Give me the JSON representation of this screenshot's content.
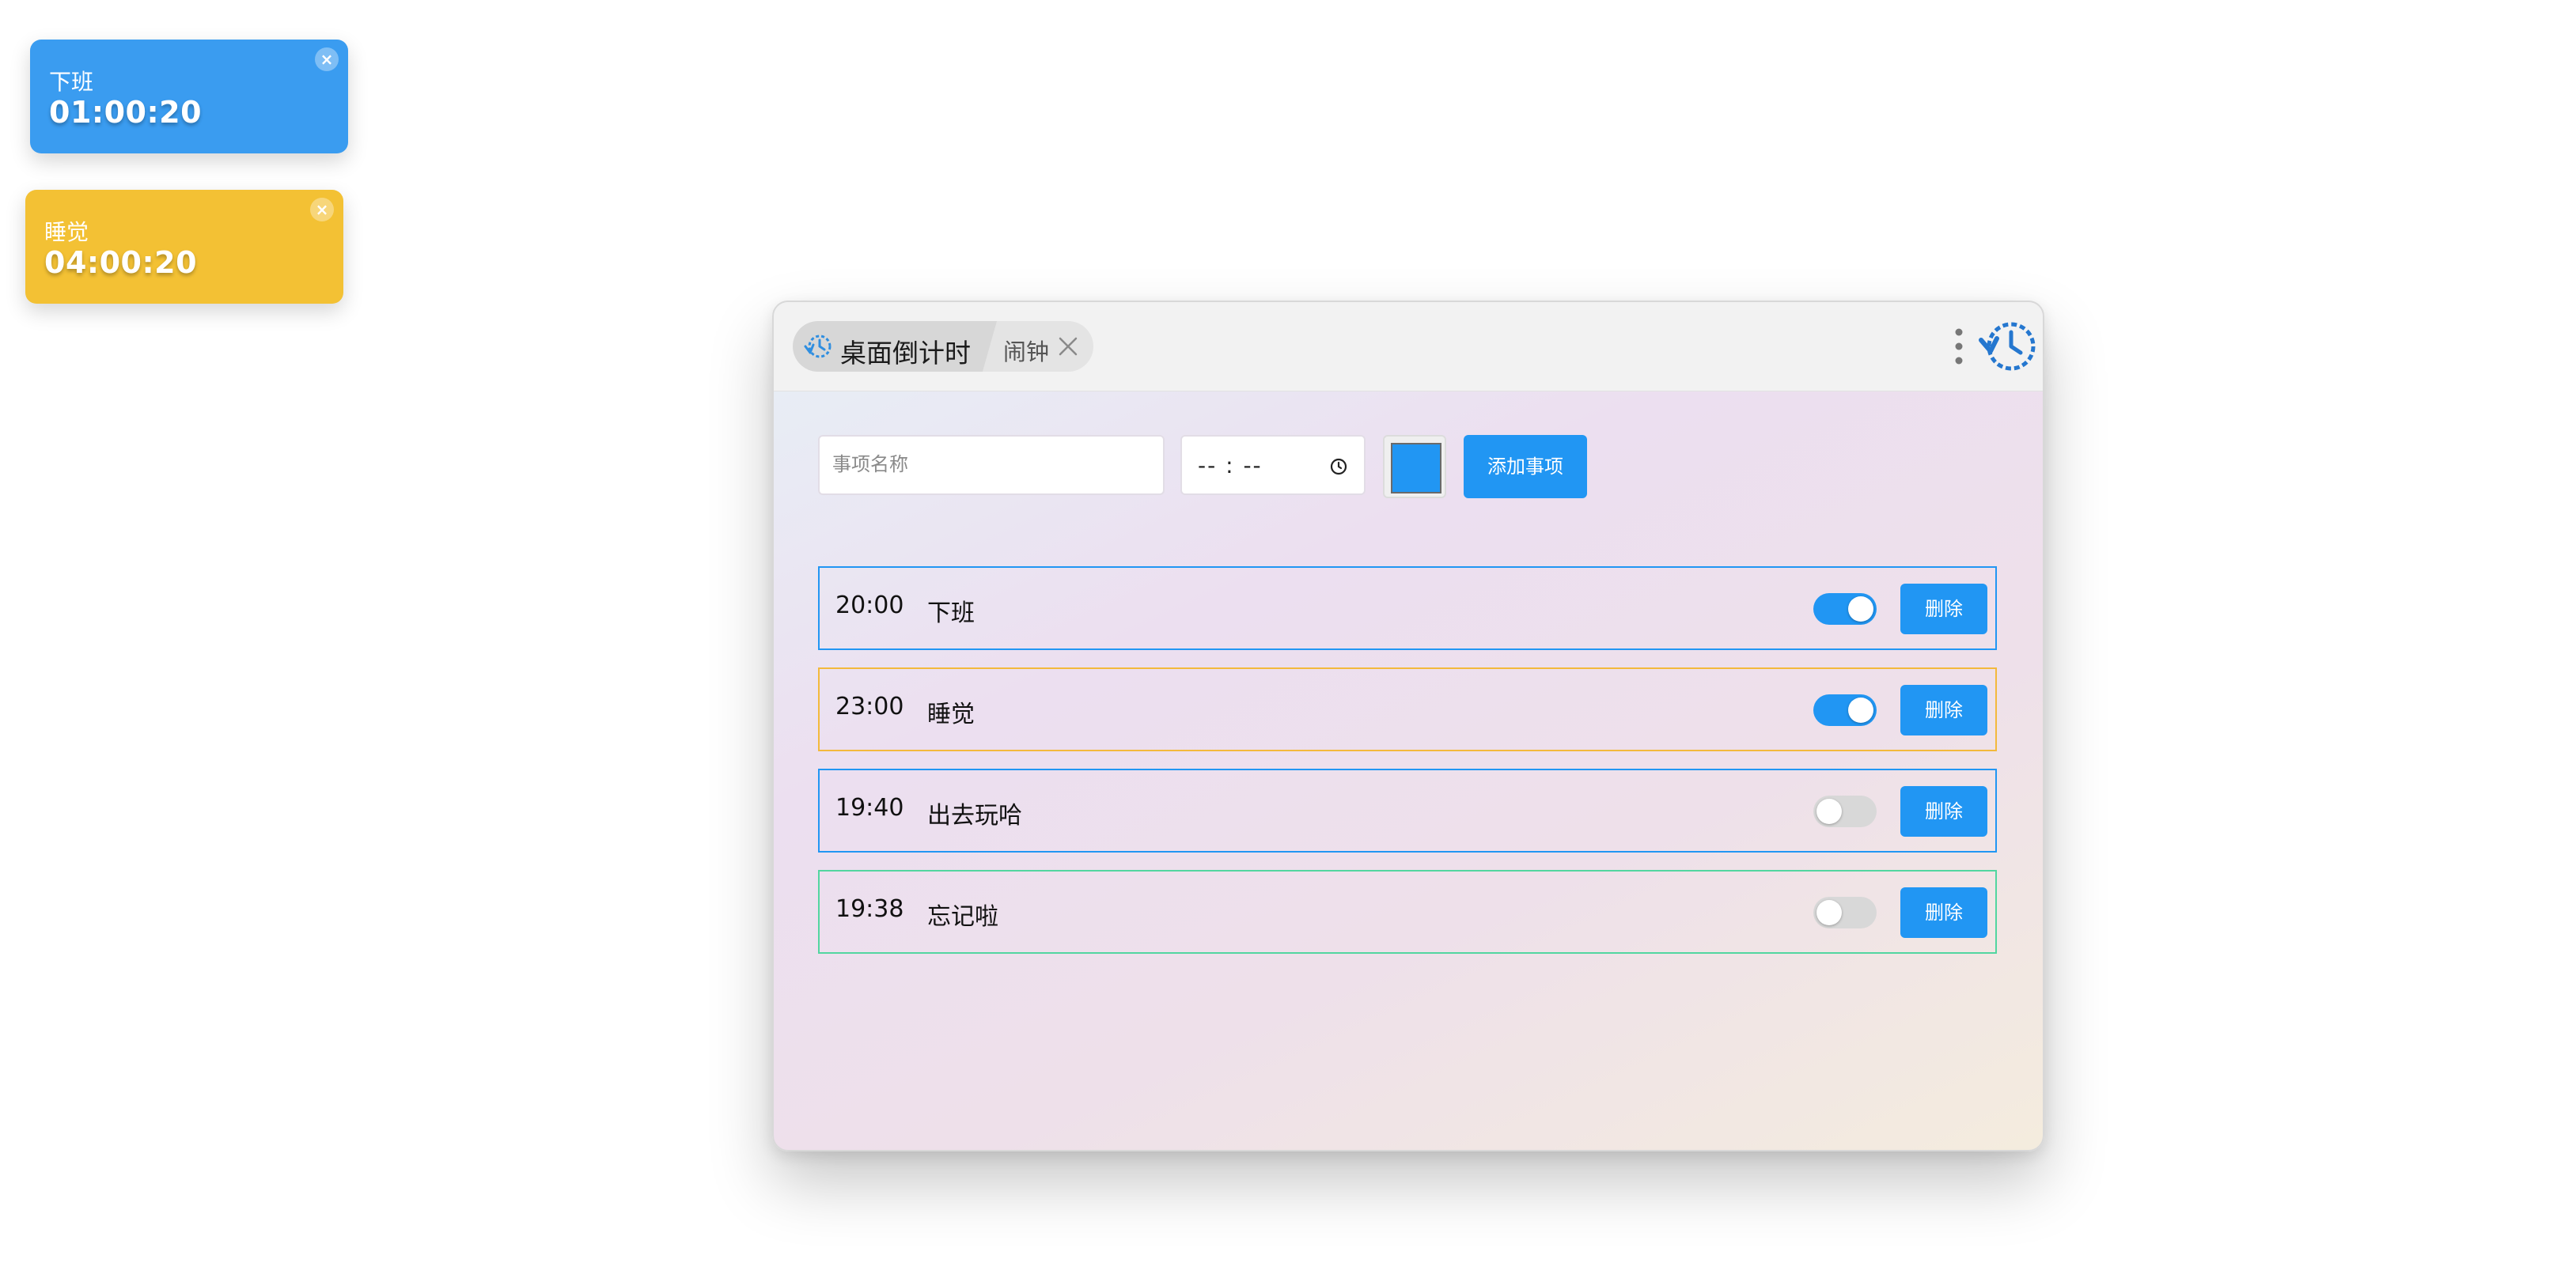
{
  "widgets": [
    {
      "title": "下班",
      "time": "01:00:20",
      "color": "#3a9cf0",
      "close": "×"
    },
    {
      "title": "睡觉",
      "time": "04:00:20",
      "color": "#f3c134",
      "close": "×"
    }
  ],
  "window": {
    "tabs": {
      "active": "桌面倒计时",
      "other": "闹钟"
    },
    "icons": {
      "tab_icon": "clock-rewind-icon",
      "close": "close-icon",
      "menu": "more-vertical-icon",
      "logo": "clock-rewind-logo"
    }
  },
  "form": {
    "name_placeholder": "事项名称",
    "time_value": "-- : --",
    "color_value": "#2196f3",
    "add_label": "添加事项"
  },
  "items": [
    {
      "time": "20:00",
      "name": "下班",
      "enabled": true,
      "border": "#2196f3",
      "delete": "删除"
    },
    {
      "time": "23:00",
      "name": "睡觉",
      "enabled": true,
      "border": "#f3b93c",
      "delete": "删除"
    },
    {
      "time": "19:40",
      "name": "出去玩哈",
      "enabled": false,
      "border": "#2196f3",
      "delete": "删除"
    },
    {
      "time": "19:38",
      "name": "忘记啦",
      "enabled": false,
      "border": "#52d6a0",
      "delete": "删除"
    }
  ],
  "colors": {
    "accent": "#2196f3",
    "toggle_off": "#d8d8d8"
  }
}
